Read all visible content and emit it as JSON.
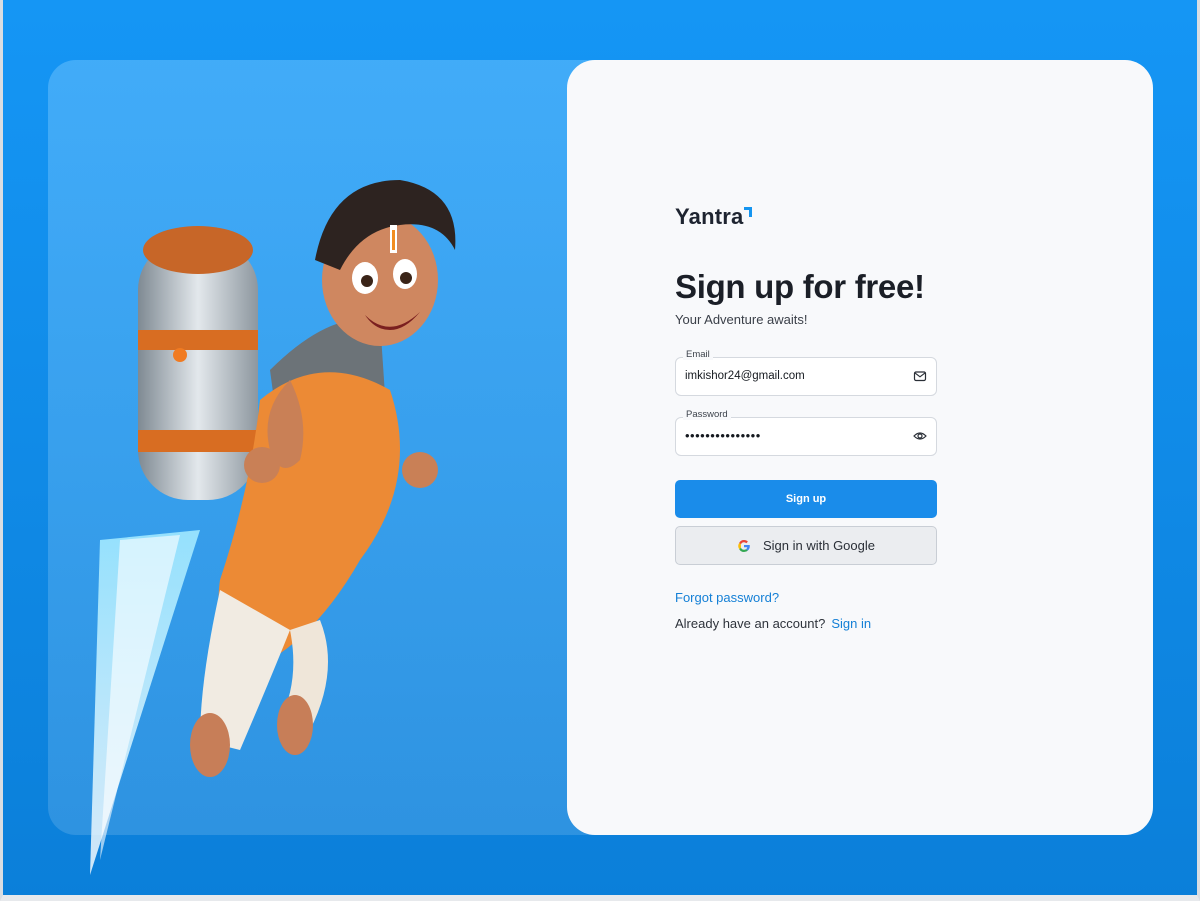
{
  "brand": {
    "name": "Yantra"
  },
  "heading": {
    "title": "Sign up for free!",
    "subtitle": "Your Adventure awaits!"
  },
  "form": {
    "email": {
      "label": "Email",
      "value": "imkishor24@gmail.com"
    },
    "password": {
      "label": "Password",
      "value": "•••••••••••••••"
    },
    "signup_label": "Sign up",
    "google_label": "Sign in with Google"
  },
  "links": {
    "forgot": "Forgot password?",
    "account_prompt": "Already have an account?",
    "signin": "Sign in"
  },
  "colors": {
    "accent": "#1a8cea",
    "background": "#1596f5",
    "card": "#f8f9fb"
  },
  "icons": [
    "mail-icon",
    "eye-icon",
    "google-icon"
  ]
}
